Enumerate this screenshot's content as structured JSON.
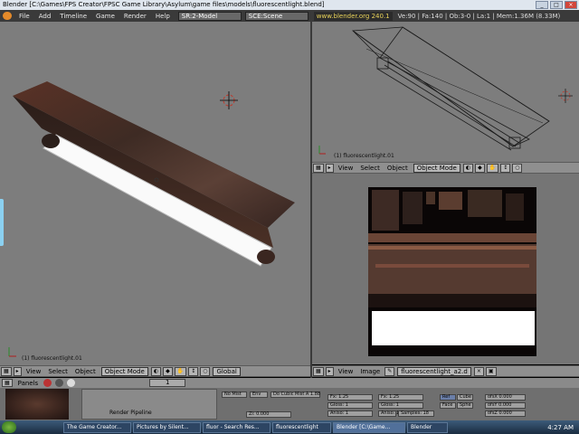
{
  "window": {
    "title": "Blender [C:\\Games\\FPS Creator\\FPSC Game Library\\Asylum\\game files\\models\\fluorescentlight.blend]",
    "controls": [
      "_",
      "□",
      "×"
    ]
  },
  "menubar": {
    "items": [
      "File",
      "Add",
      "Timeline",
      "Game",
      "Render",
      "Help"
    ],
    "screen": "SR:2-Model",
    "scene": "SCE:Scene",
    "site": "www.blender.org 240.1",
    "stats": "Ve:90 | Fa:140 | Ob:3-0 | La:1 | Mem:1.36M (8.33M)"
  },
  "viewports": {
    "main_label": "(1) fluorescentlight.01",
    "top_label": "(1) fluorescentlight.01"
  },
  "header_main": {
    "items": [
      "View",
      "Select",
      "Object"
    ],
    "mode": "Object Mode",
    "orientation": "Global"
  },
  "header_top": {
    "items": [
      "View",
      "Select",
      "Object"
    ],
    "mode": "Object Mode"
  },
  "header_img": {
    "items": [
      "View",
      "Image"
    ],
    "image_name": "fluorescentlight_a2.d"
  },
  "buttons_panel": {
    "panels_label": "Panels",
    "frame": "1",
    "render_pipeline": "Render Pipeline",
    "mist": "No Mist",
    "env": "Env",
    "zbuf": "Do Cubic Mist A 1.88",
    "z_value": "Zi: 0.000",
    "fx1": "Fx: 1.25",
    "fx2": "Fx: 1.25",
    "gloss1": "Gloss: 1",
    "gloss2": "Gloss: 1",
    "aniso": "Aniso: 1",
    "aniso2": "Aniso: 1",
    "samples": "Samples: 18",
    "mode_a": "Ref",
    "mode_b": "Cube",
    "mode_c": "Face",
    "mode_d": "Sphe",
    "sz1": "ofsX 0.000",
    "sz2": "ofsY 0.000",
    "sz3": "ofsZ 0.000"
  },
  "taskbar": {
    "tasks": [
      "The Game Creator...",
      "Pictures by Silent...",
      "fluor - Search Res...",
      "fluorescentlight",
      "Blender [C:\\Game...",
      "Blender"
    ],
    "clock": "4:27 AM"
  }
}
